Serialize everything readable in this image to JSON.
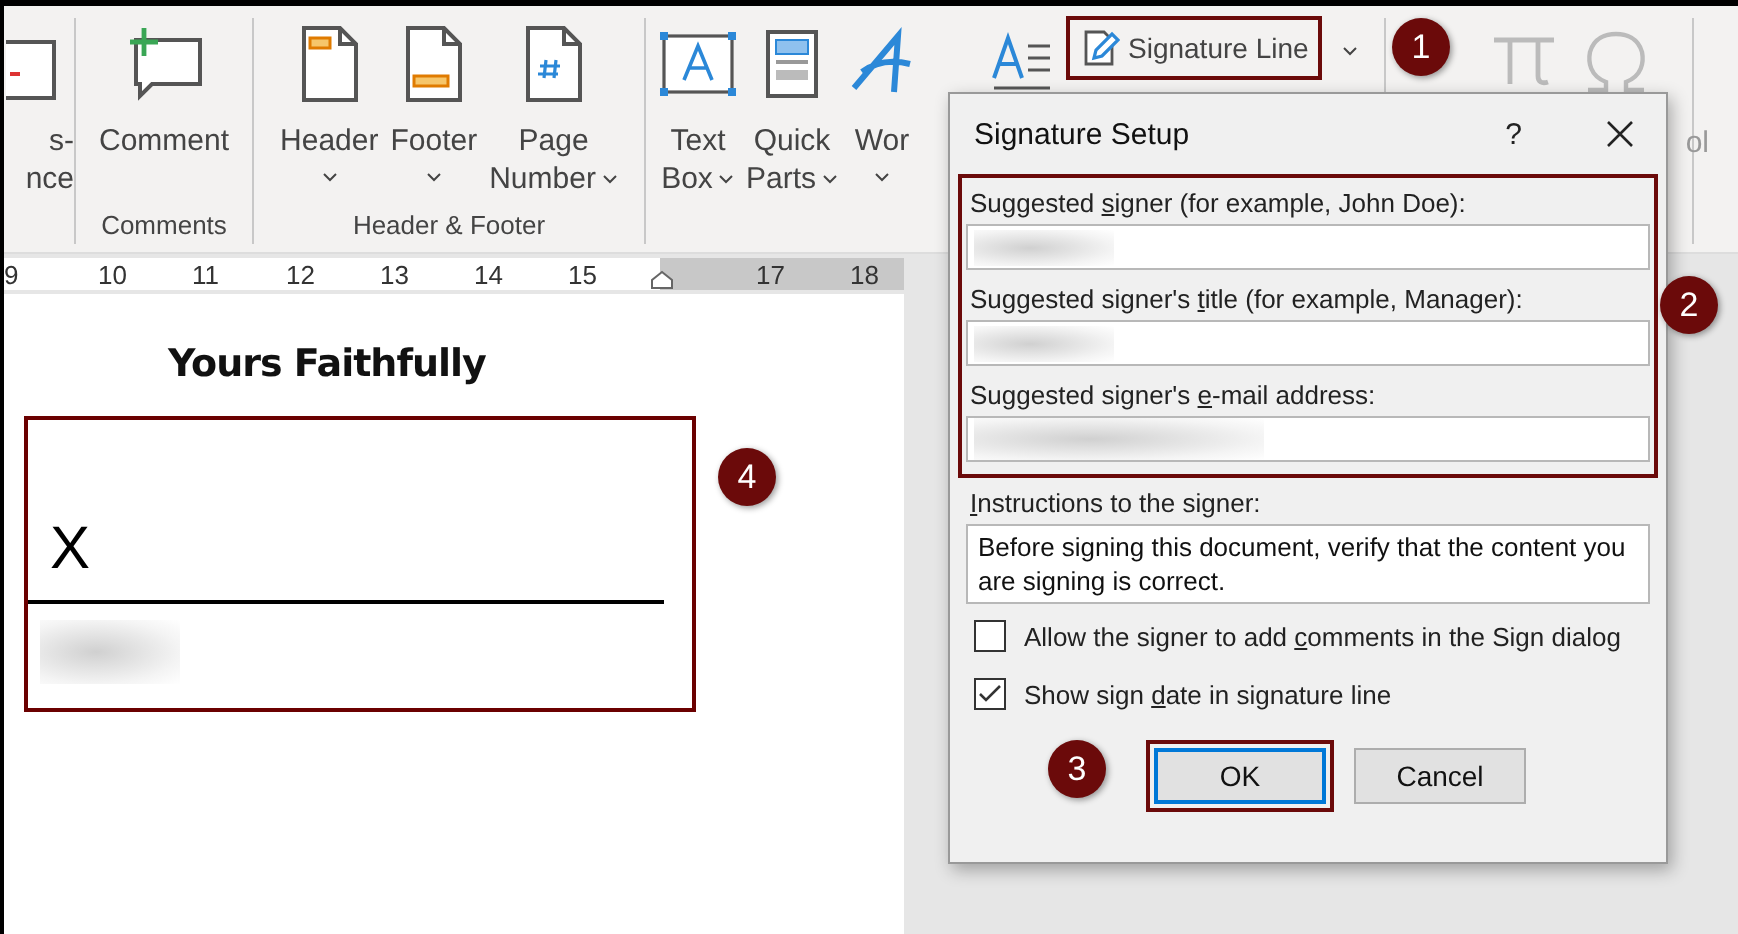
{
  "ribbon": {
    "groups": [
      {
        "buttons": [
          {
            "kind": "cut",
            "lines": [
              "s-",
              "nce"
            ],
            "dropdown": false
          }
        ]
      },
      {
        "label": "Comments",
        "buttons": [
          {
            "kind": "comment",
            "lines": [
              "Comment"
            ],
            "dropdown": false
          }
        ]
      },
      {
        "label": "Header & Footer",
        "buttons": [
          {
            "kind": "header",
            "lines": [
              "Header"
            ],
            "dropdown": true
          },
          {
            "kind": "footer",
            "lines": [
              "Footer"
            ],
            "dropdown": true
          },
          {
            "kind": "page-number",
            "lines": [
              "Page",
              "Number"
            ],
            "dropdown": true
          }
        ]
      },
      {
        "buttons": [
          {
            "kind": "text-box",
            "lines": [
              "Text",
              "Box"
            ],
            "dropdown": true
          },
          {
            "kind": "quick-parts",
            "lines": [
              "Quick",
              "Parts"
            ],
            "dropdown": true
          },
          {
            "kind": "wordart",
            "lines": [
              "Wor"
            ],
            "dropdown": true
          }
        ]
      }
    ],
    "signature_line": {
      "label": "Signature Line",
      "highlighted": true
    },
    "equation": {
      "disabled": true
    },
    "symbol": {
      "label": "ol",
      "disabled": true
    }
  },
  "ruler": {
    "numbers": [
      "9",
      "10",
      "11",
      "12",
      "13",
      "14",
      "15",
      "17",
      "18"
    ]
  },
  "document": {
    "heading": "Yours Faithfully",
    "signature_box": {
      "x_mark": "X",
      "signer_redacted": true,
      "highlighted": true
    }
  },
  "dialog": {
    "title": "Signature Setup",
    "help": "?",
    "signer_section": {
      "highlighted": true,
      "fields": [
        {
          "label": {
            "before": "Suggested ",
            "key": "s",
            "after": "igner (for example, John Doe):"
          },
          "redacted": true
        },
        {
          "label": {
            "before": "Suggested signer's ",
            "key": "t",
            "after": "itle (for example, Manager):"
          },
          "redacted": true
        },
        {
          "label": {
            "before": "Suggested signer's ",
            "key": "e",
            "after": "-mail address:"
          },
          "redacted": true
        }
      ]
    },
    "instructions": {
      "label": {
        "key": "I",
        "after": "nstructions to the signer:"
      },
      "value": "Before signing this document, verify that the content you are signing is correct."
    },
    "checkboxes": [
      {
        "label": {
          "before": "Allow the signer to add ",
          "key": "c",
          "after": "omments in the Sign dialog"
        },
        "checked": false
      },
      {
        "label": {
          "before": "Show sign ",
          "key": "d",
          "after": "ate in signature line"
        },
        "checked": true
      }
    ],
    "buttons": [
      {
        "label": "OK",
        "default": true,
        "highlighted": true
      },
      {
        "label": "Cancel",
        "default": false,
        "highlighted": false
      }
    ]
  },
  "callouts": [
    {
      "number": "1"
    },
    {
      "number": "2"
    },
    {
      "number": "3"
    },
    {
      "number": "4"
    }
  ]
}
